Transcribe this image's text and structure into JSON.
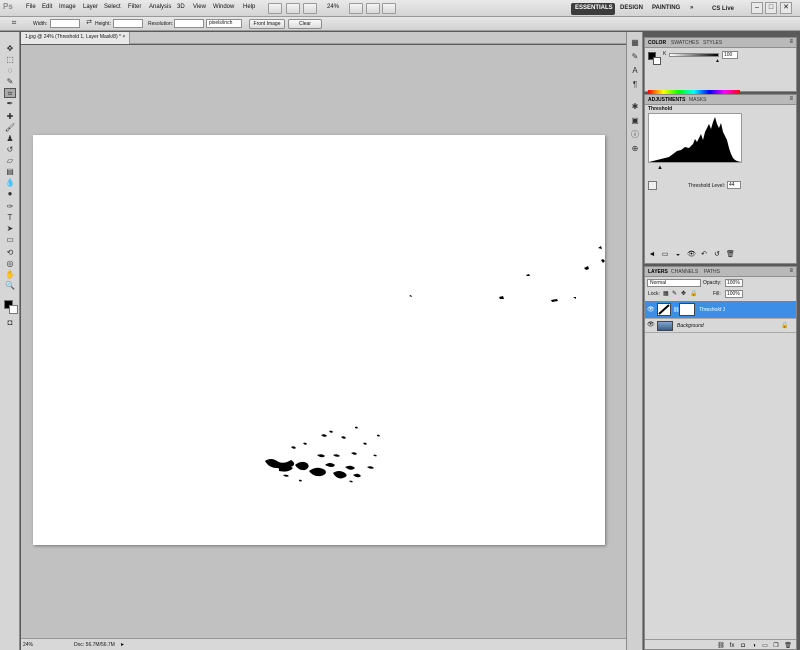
{
  "menubar": {
    "logo": "Ps",
    "menus": [
      "File",
      "Edit",
      "Image",
      "Layer",
      "Select",
      "Filter",
      "Analysis",
      "3D",
      "View",
      "Window",
      "Help"
    ],
    "zoom": "24%",
    "workspaces": {
      "essentials": "ESSENTIALS",
      "design": "DESIGN",
      "painting": "PAINTING",
      "more": "»"
    },
    "cs_live": "CS Live",
    "window_buttons": {
      "minimize": "–",
      "restore": "□",
      "close": "✕"
    }
  },
  "options": {
    "width_label": "Width:",
    "height_label": "Height:",
    "resolution_label": "Resolution:",
    "resolution_unit": "pixels/inch",
    "front_image": "Front Image",
    "clear": "Clear",
    "width_value": "",
    "height_value": "",
    "resolution_value": ""
  },
  "document": {
    "tab_title": "1.jpg @ 24% (Threshold 1, Layer Mask/8) *",
    "zoom": "24%",
    "doc_info": "Doc: 56.7M/56.7M"
  },
  "color_panel": {
    "tabs": [
      "COLOR",
      "SWATCHES",
      "STYLES"
    ],
    "channel": "K",
    "value": "100"
  },
  "adjustments_panel": {
    "tabs": [
      "ADJUSTMENTS",
      "MASKS"
    ],
    "title": "Threshold",
    "level_label": "Threshold Level:",
    "level_value": "44"
  },
  "layers_panel": {
    "tabs": [
      "LAYERS",
      "CHANNELS",
      "PATHS"
    ],
    "blend_mode": "Normal",
    "opacity_label": "Opacity:",
    "opacity_value": "100%",
    "lock_label": "Lock:",
    "fill_label": "Fill:",
    "fill_value": "100%",
    "layers": [
      {
        "name": "Threshold 1",
        "selected": true
      },
      {
        "name": "Background",
        "selected": false
      }
    ]
  },
  "colors": {
    "accent_selected_layer": "#3d8ee6",
    "canvas_bg": "#c1c1c1",
    "workspace_essentials_bg": "#3c3c3c"
  }
}
